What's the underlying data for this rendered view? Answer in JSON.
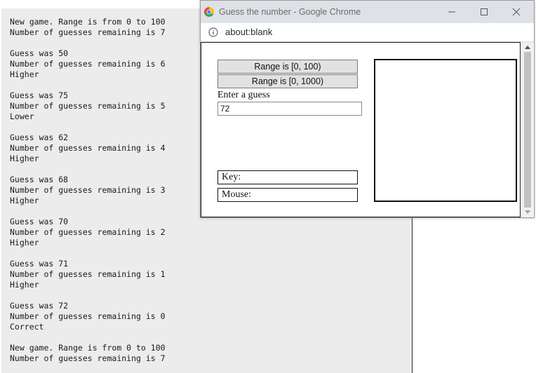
{
  "console": {
    "lines": [
      "New game. Range is from 0 to 100",
      "Number of guesses remaining is 7",
      "",
      "Guess was 50",
      "Number of guesses remaining is 6",
      "Higher",
      "",
      "Guess was 75",
      "Number of guesses remaining is 5",
      "Lower",
      "",
      "Guess was 62",
      "Number of guesses remaining is 4",
      "Higher",
      "",
      "Guess was 68",
      "Number of guesses remaining is 3",
      "Higher",
      "",
      "Guess was 70",
      "Number of guesses remaining is 2",
      "Higher",
      "",
      "Guess was 71",
      "Number of guesses remaining is 1",
      "Higher",
      "",
      "Guess was 72",
      "Number of guesses remaining is 0",
      "Correct",
      "",
      "New game. Range is from 0 to 100",
      "Number of guesses remaining is 7"
    ]
  },
  "window": {
    "title": "Guess the number - Google Chrome",
    "url": "about:blank"
  },
  "controls": {
    "range100_label": "Range is [0, 100)",
    "range1000_label": "Range is [0, 1000)",
    "guess_label": "Enter a guess",
    "guess_value": "72",
    "key_label": "Key:",
    "mouse_label": "Mouse:"
  },
  "icons": {
    "browser": "chrome-logo-icon",
    "info": "info-icon",
    "minimize": "minimize-icon",
    "maximize": "maximize-icon",
    "close": "close-icon"
  }
}
